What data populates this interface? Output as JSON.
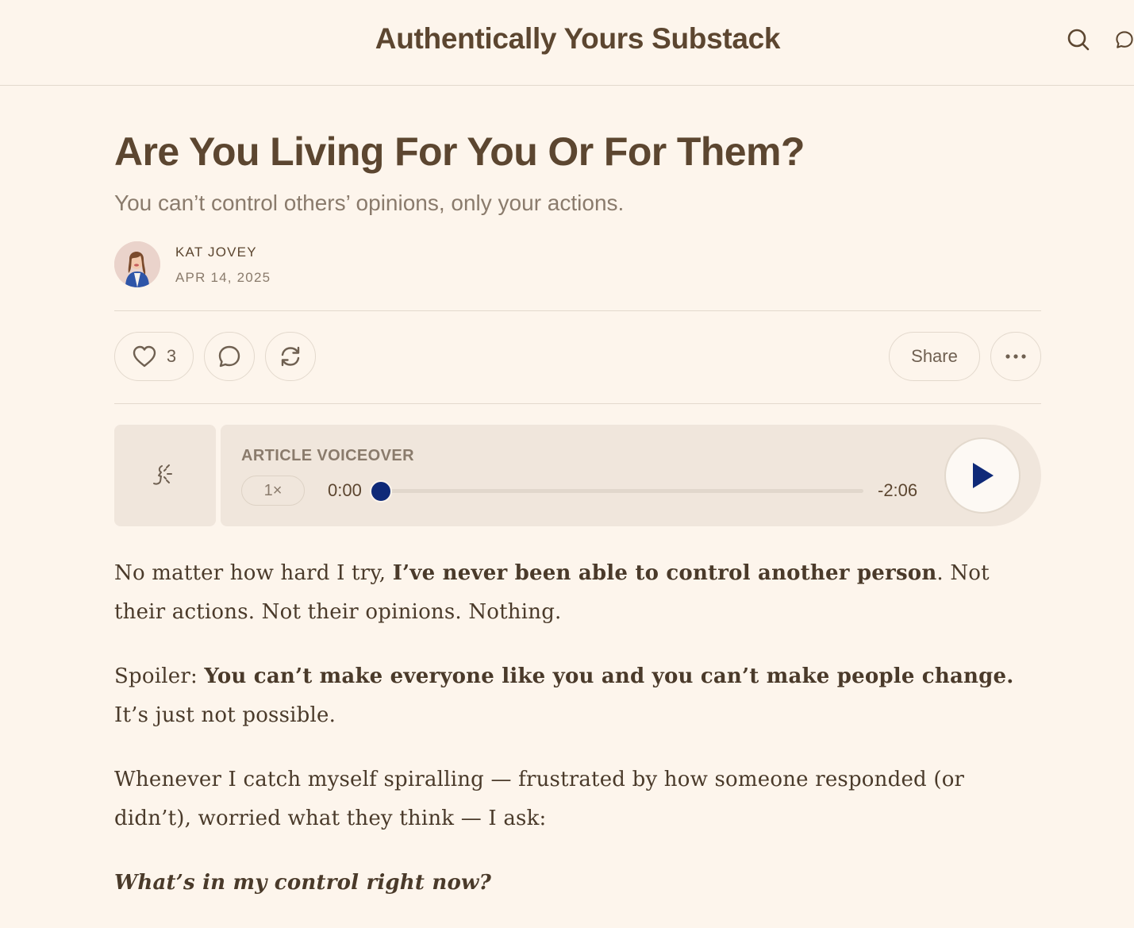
{
  "header": {
    "site_title": "Authentically Yours Substack",
    "search_icon": "search-icon",
    "chat_icon": "chat-bubble-icon"
  },
  "post": {
    "title": "Are You Living For You Or For Them?",
    "subtitle": "You can’t control others’ opinions, only your actions.",
    "author": "KAT JOVEY",
    "date": "APR 14, 2025"
  },
  "actions": {
    "like_count": "3",
    "share_label": "Share",
    "icons": [
      "heart-icon",
      "comment-icon",
      "restack-icon",
      "more-icon"
    ]
  },
  "voiceover": {
    "label": "ARTICLE VOICEOVER",
    "speed": "1×",
    "current_time": "0:00",
    "remaining_time": "-2:06",
    "progress": 0,
    "accent_color": "#0f2a78"
  },
  "body": {
    "p1_a": "No matter how hard I try, ",
    "p1_b": "I’ve never been able to control another person",
    "p1_c": ". Not their actions. Not their opinions. Nothing.",
    "p2_a": "Spoiler: ",
    "p2_b": "You can’t make everyone like you and you can’t make people change.",
    "p2_c": " It’s just not possible.",
    "p3": "Whenever I catch myself spiralling — frustrated by how someone responded (or didn’t), worried what they think — I ask:",
    "p4": "What’s in my control right now?"
  }
}
